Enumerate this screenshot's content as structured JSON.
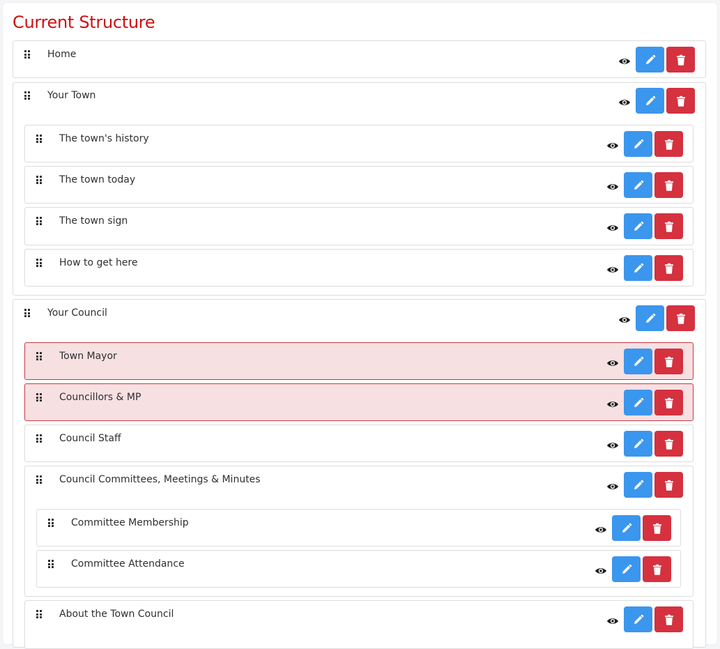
{
  "page": {
    "title": "Current Structure"
  },
  "items": [
    {
      "label": "Home"
    },
    {
      "label": "Your Town"
    },
    {
      "label": "The town's history"
    },
    {
      "label": "The town today"
    },
    {
      "label": "The town sign"
    },
    {
      "label": "How to get here"
    },
    {
      "label": "Your Council"
    },
    {
      "label": "Town Mayor",
      "highlighted": true
    },
    {
      "label": "Councillors & MP",
      "highlighted": true
    },
    {
      "label": "Council Staff"
    },
    {
      "label": "Council Committees, Meetings & Minutes"
    },
    {
      "label": "Committee Membership"
    },
    {
      "label": "Committee Attendance"
    },
    {
      "label": "About the Town Council"
    }
  ],
  "icons": {
    "drag": "drag-handle-icon",
    "view": "eye-icon",
    "edit": "pencil-icon",
    "delete": "trash-icon"
  },
  "colors": {
    "title": "#cc1111",
    "edit_button": "#3b96ee",
    "delete_button": "#d5313f",
    "highlight_background": "#f7e0e2",
    "highlight_border": "#c8373f"
  }
}
